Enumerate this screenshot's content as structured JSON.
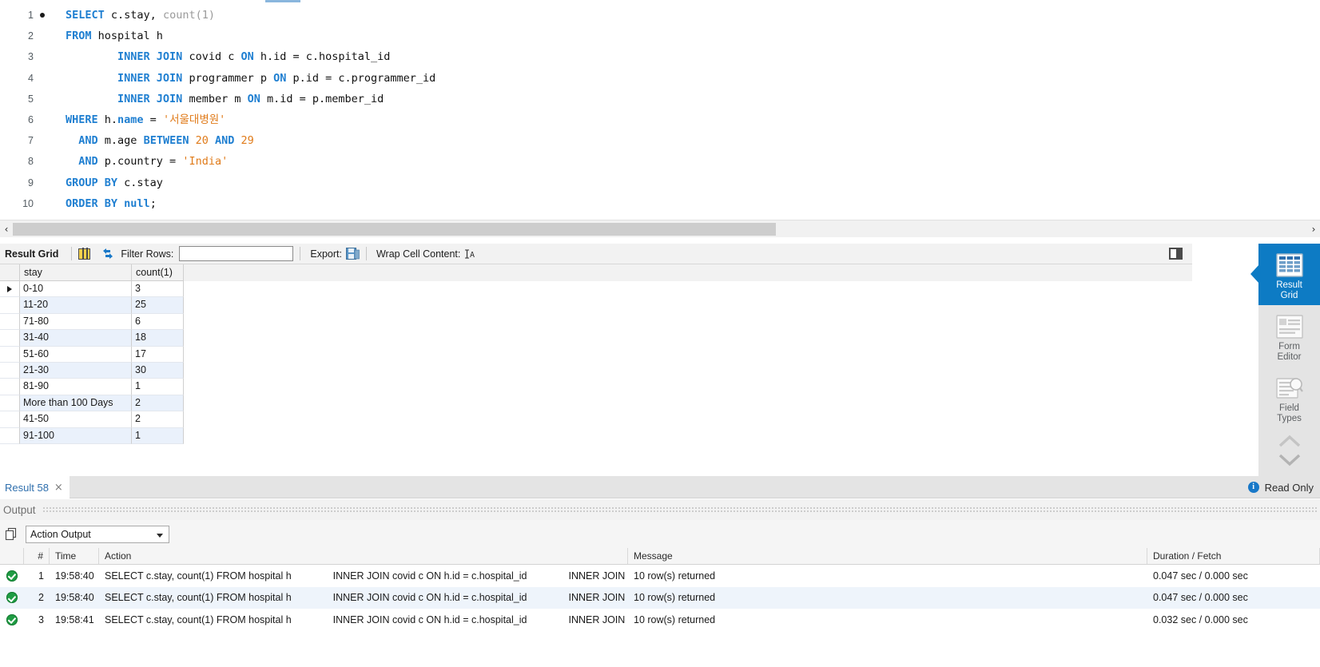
{
  "editor": {
    "lines": [
      {
        "num": "1",
        "breakpoint": true,
        "tokens": [
          {
            "t": "SELECT",
            "c": "kw"
          },
          {
            "t": " c.stay, ",
            "c": "pl"
          },
          {
            "t": "count",
            "c": "fn"
          },
          {
            "t": "(",
            "c": "fn"
          },
          {
            "t": "1",
            "c": "fn"
          },
          {
            "t": ")",
            "c": "fn"
          }
        ]
      },
      {
        "num": "2",
        "breakpoint": false,
        "tokens": [
          {
            "t": "FROM",
            "c": "kw"
          },
          {
            "t": " hospital h",
            "c": "pl"
          }
        ]
      },
      {
        "num": "3",
        "breakpoint": false,
        "tokens": [
          {
            "t": "        ",
            "c": "pl"
          },
          {
            "t": "INNER JOIN",
            "c": "kw"
          },
          {
            "t": " covid c ",
            "c": "pl"
          },
          {
            "t": "ON",
            "c": "kw"
          },
          {
            "t": " h.id = c.hospital_id",
            "c": "pl"
          }
        ]
      },
      {
        "num": "4",
        "breakpoint": false,
        "tokens": [
          {
            "t": "        ",
            "c": "pl"
          },
          {
            "t": "INNER JOIN",
            "c": "kw"
          },
          {
            "t": " programmer p ",
            "c": "pl"
          },
          {
            "t": "ON",
            "c": "kw"
          },
          {
            "t": " p.id = c.programmer_id",
            "c": "pl"
          }
        ]
      },
      {
        "num": "5",
        "breakpoint": false,
        "tokens": [
          {
            "t": "        ",
            "c": "pl"
          },
          {
            "t": "INNER JOIN",
            "c": "kw"
          },
          {
            "t": " member m ",
            "c": "pl"
          },
          {
            "t": "ON",
            "c": "kw"
          },
          {
            "t": " m.id = p.member_id",
            "c": "pl"
          }
        ]
      },
      {
        "num": "6",
        "breakpoint": false,
        "tokens": [
          {
            "t": "WHERE",
            "c": "kw"
          },
          {
            "t": " h.",
            "c": "pl"
          },
          {
            "t": "name",
            "c": "kw"
          },
          {
            "t": " = ",
            "c": "pl"
          },
          {
            "t": "'서울대병원'",
            "c": "str"
          }
        ]
      },
      {
        "num": "7",
        "breakpoint": false,
        "tokens": [
          {
            "t": "  ",
            "c": "pl"
          },
          {
            "t": "AND",
            "c": "kw"
          },
          {
            "t": " m.age ",
            "c": "pl"
          },
          {
            "t": "BETWEEN",
            "c": "kw"
          },
          {
            "t": " ",
            "c": "pl"
          },
          {
            "t": "20",
            "c": "num"
          },
          {
            "t": " ",
            "c": "pl"
          },
          {
            "t": "AND",
            "c": "kw"
          },
          {
            "t": " ",
            "c": "pl"
          },
          {
            "t": "29",
            "c": "num"
          }
        ]
      },
      {
        "num": "8",
        "breakpoint": false,
        "tokens": [
          {
            "t": "  ",
            "c": "pl"
          },
          {
            "t": "AND",
            "c": "kw"
          },
          {
            "t": " p.country = ",
            "c": "pl"
          },
          {
            "t": "'India'",
            "c": "str"
          }
        ]
      },
      {
        "num": "9",
        "breakpoint": false,
        "tokens": [
          {
            "t": "GROUP BY",
            "c": "kw"
          },
          {
            "t": " c.stay",
            "c": "pl"
          }
        ]
      },
      {
        "num": "10",
        "breakpoint": false,
        "tokens": [
          {
            "t": "ORDER BY",
            "c": "kw"
          },
          {
            "t": " ",
            "c": "pl"
          },
          {
            "t": "null",
            "c": "kw"
          },
          {
            "t": ";",
            "c": "pl"
          }
        ]
      }
    ]
  },
  "grid_toolbar": {
    "title": "Result Grid",
    "filter_label": "Filter Rows:",
    "filter_value": "",
    "filter_placeholder": "",
    "export_label": "Export:",
    "wrap_label": "Wrap Cell Content:"
  },
  "result_grid": {
    "columns": [
      "stay",
      "count(1)"
    ],
    "rows": [
      [
        "0-10",
        "3"
      ],
      [
        "11-20",
        "25"
      ],
      [
        "71-80",
        "6"
      ],
      [
        "31-40",
        "18"
      ],
      [
        "51-60",
        "17"
      ],
      [
        "21-30",
        "30"
      ],
      [
        "81-90",
        "1"
      ],
      [
        "More than 100 Days",
        "2"
      ],
      [
        "41-50",
        "2"
      ],
      [
        "91-100",
        "1"
      ]
    ]
  },
  "side_panel": {
    "items": [
      {
        "label_line1": "Result",
        "label_line2": "Grid",
        "active": true
      },
      {
        "label_line1": "Form",
        "label_line2": "Editor",
        "active": false
      },
      {
        "label_line1": "Field",
        "label_line2": "Types",
        "active": false
      }
    ],
    "accent_color": "#0d7bc4"
  },
  "result_tab": {
    "label": "Result 58",
    "close": "×",
    "readonly_label": "Read Only",
    "info_glyph": "i"
  },
  "output": {
    "panel_label": "Output",
    "selector_value": "Action Output",
    "columns": [
      "#",
      "Time",
      "Action",
      "Message",
      "Duration / Fetch"
    ],
    "rows": [
      {
        "status": "success",
        "num": "1",
        "time": "19:58:40",
        "action_1": "SELECT c.stay, count(1) FROM hospital h",
        "action_2": "INNER JOIN covid c ON h.id = c.hospital_id",
        "action_3": "INNER JOIN ...",
        "message": "10 row(s) returned",
        "duration": "0.047 sec / 0.000 sec"
      },
      {
        "status": "success",
        "num": "2",
        "time": "19:58:40",
        "action_1": "SELECT c.stay, count(1) FROM hospital h",
        "action_2": "INNER JOIN covid c ON h.id = c.hospital_id",
        "action_3": "INNER JOIN ...",
        "message": "10 row(s) returned",
        "duration": "0.047 sec / 0.000 sec"
      },
      {
        "status": "success",
        "num": "3",
        "time": "19:58:41",
        "action_1": "SELECT c.stay, count(1) FROM hospital h",
        "action_2": "INNER JOIN covid c ON h.id = c.hospital_id",
        "action_3": "INNER JOIN ...",
        "message": "10 row(s) returned",
        "duration": "0.032 sec / 0.000 sec"
      }
    ]
  },
  "scrollbar": {
    "left_arrow": "‹",
    "right_arrow": "›"
  }
}
